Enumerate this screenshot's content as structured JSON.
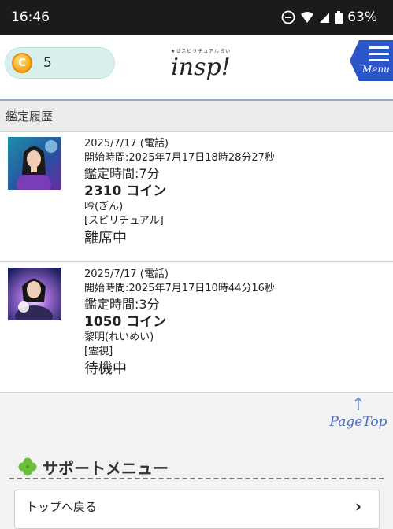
{
  "statusbar": {
    "time": "16:46",
    "battery": "63%"
  },
  "header": {
    "coin_symbol": "C",
    "coin_count": "5",
    "logo_sub": "★せスピリチュアル占い",
    "logo_main": "insp!",
    "menu_label": "Menu"
  },
  "section_title": "鑑定履歴",
  "history": [
    {
      "date": "2025/7/17 (電話)",
      "start": "開始時間:2025年7月17日18時28分27秒",
      "duration": "鑑定時間:7分",
      "coins": "2310 コイン",
      "name": "吟(ぎん)",
      "category": "[スピリチュアル]",
      "status": "離席中"
    },
    {
      "date": "2025/7/17 (電話)",
      "start": "開始時間:2025年7月17日10時44分16秒",
      "duration": "鑑定時間:3分",
      "coins": "1050 コイン",
      "name": "黎明(れいめい)",
      "category": "[霊視]",
      "status": "待機中"
    }
  ],
  "pagetop_label": "PageTop",
  "support": {
    "title": "サポートメニュー",
    "back_label": "トップへ戻る"
  },
  "colors": {
    "accent": "#2a56c9",
    "coin_bg": "#d9f1ee",
    "clover": "#6cbf3a"
  }
}
